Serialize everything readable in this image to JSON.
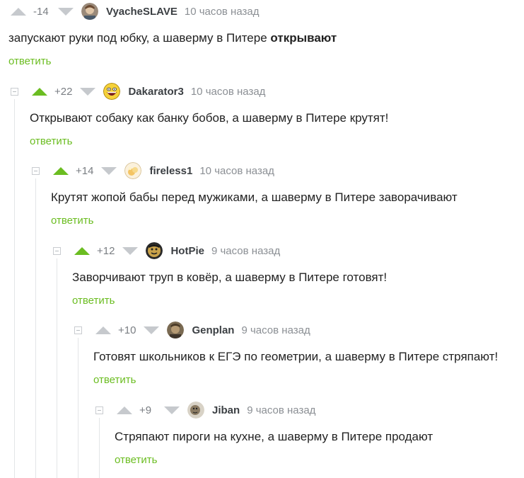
{
  "comments": [
    {
      "rating": "-14",
      "up_active": false,
      "avatar": "avatar-vyacheslave",
      "user": "VyacheSLAVE",
      "time": "10 часов назад",
      "text": "запускают руки под юбку, а шаверму в Питере ",
      "text_bold": "открывают",
      "reply": "ответить"
    },
    {
      "rating": "+22",
      "up_active": true,
      "avatar": "avatar-dakarator3",
      "user": "Dakarator3",
      "time": "10 часов назад",
      "text": "Открывают собаку как банку бобов, а шаверму в Питере крутят!",
      "reply": "ответить"
    },
    {
      "rating": "+14",
      "up_active": true,
      "avatar": "avatar-fireless1",
      "user": "fireless1",
      "time": "10 часов назад",
      "text": "Крутят жопой бабы перед мужиками, а шаверму в Питере заворачивают",
      "reply": "ответить"
    },
    {
      "rating": "+12",
      "up_active": true,
      "avatar": "avatar-hotpie",
      "user": "HotPie",
      "time": "9 часов назад",
      "text": "Заворчивают труп в ковёр, а шаверму в Питере готовят!",
      "reply": "ответить"
    },
    {
      "rating": "+10",
      "up_active": false,
      "avatar": "avatar-genplan",
      "user": "Genplan",
      "time": "9 часов назад",
      "text": "Готовят школьников к ЕГЭ по геометрии, а шаверму в Питере стряпают!",
      "reply": "ответить"
    },
    {
      "rating": "+9",
      "up_active": false,
      "avatar": "avatar-jiban",
      "user": "Jiban",
      "time": "9 часов назад",
      "text": "Стряпают пироги на кухне, а шаверму в Питере продают",
      "reply": "ответить"
    }
  ],
  "colors": {
    "accent_green": "#6bbd21",
    "arrow_inactive": "#c6c9cd",
    "muted": "#8b8f94"
  }
}
